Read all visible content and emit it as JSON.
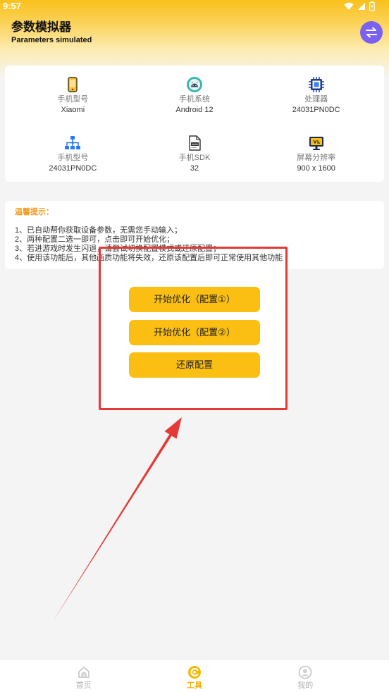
{
  "status_bar": {
    "time": "9:57",
    "icons": [
      "wifi-icon",
      "signal-icon",
      "battery-icon"
    ]
  },
  "header": {
    "title": "参数模拟器",
    "subtitle": "Parameters simulated",
    "action_icon": "swap-arrows-icon"
  },
  "device_info": [
    {
      "icon": "phone-icon",
      "label": "手机型号",
      "value": "Xiaomi"
    },
    {
      "icon": "android-icon",
      "label": "手机系统",
      "value": "Android 12"
    },
    {
      "icon": "chip-icon",
      "label": "处理器",
      "value": "24031PN0DC"
    },
    {
      "icon": "hierarchy-icon",
      "label": "手机型号",
      "value": "24031PN0DC"
    },
    {
      "icon": "sdk-icon",
      "label": "手机SDK",
      "value": "32"
    },
    {
      "icon": "monitor-icon",
      "label": "屏幕分辨率",
      "value": "900 x 1600"
    }
  ],
  "tips": {
    "title": "温馨提示：",
    "lines": [
      "1、已自动帮你获取设备参数，无需您手动输入；",
      "2、两种配置二选一即可，点击即可开始优化；",
      "3、若进游戏时发生闪退，请尝试切换配置模式或还原配置；",
      "4、使用该功能后，其他画质功能将失效，还原该配置后即可正常使用其他功能"
    ]
  },
  "actions": {
    "optimize_1": "开始优化（配置①）",
    "optimize_2": "开始优化（配置②）",
    "restore": "还原配置"
  },
  "nav": {
    "items": [
      {
        "label": "首页",
        "icon": "home-icon",
        "active": false
      },
      {
        "label": "工具",
        "icon": "tool-icon",
        "active": true
      },
      {
        "label": "我的",
        "icon": "profile-icon",
        "active": false
      }
    ]
  },
  "colors": {
    "accent": "#fbbf14",
    "tip": "#f29a1c",
    "annot": "#e53935",
    "swap": "#7b61f2"
  }
}
